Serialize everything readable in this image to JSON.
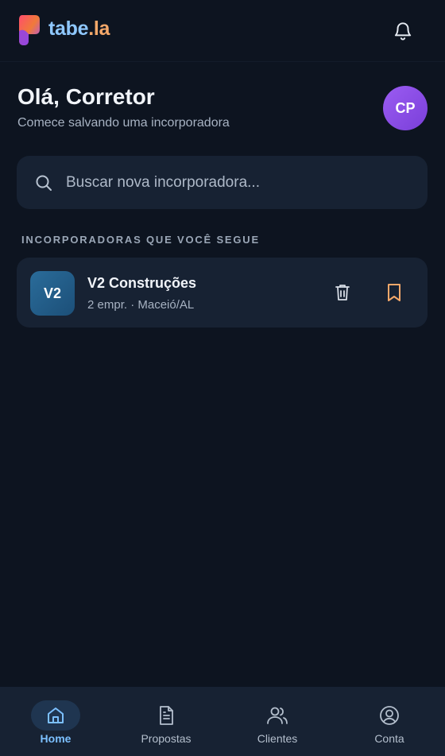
{
  "header": {
    "logo_part1": "tabe",
    "logo_part2": ".la",
    "logo_icon": "tabela-logo-icon",
    "notifications_icon": "bell-icon"
  },
  "greeting": {
    "title": "Olá, Corretor",
    "subtitle": "Comece salvando uma incorporadora",
    "avatar_initials": "CP"
  },
  "search": {
    "placeholder": "Buscar nova incorporadora...",
    "value": "",
    "icon": "search-icon"
  },
  "following": {
    "section_title": "INCORPORADORAS QUE VOCÊ SEGUE",
    "items": [
      {
        "logo_initials": "V2",
        "name": "V2 Construções",
        "meta": "2 empr. · Maceió/AL",
        "delete_icon": "trash-icon",
        "bookmark_icon": "bookmark-icon"
      }
    ]
  },
  "bottom_nav": {
    "items": [
      {
        "label": "Home",
        "icon": "home-icon",
        "active": true
      },
      {
        "label": "Propostas",
        "icon": "document-icon",
        "active": false
      },
      {
        "label": "Clientes",
        "icon": "users-icon",
        "active": false
      },
      {
        "label": "Conta",
        "icon": "account-icon",
        "active": false
      }
    ]
  },
  "colors": {
    "background": "#0d1420",
    "surface": "#172233",
    "accent_blue": "#7cc0ff",
    "accent_orange": "#f4a86a",
    "avatar_purple": "#8b4fe8"
  }
}
